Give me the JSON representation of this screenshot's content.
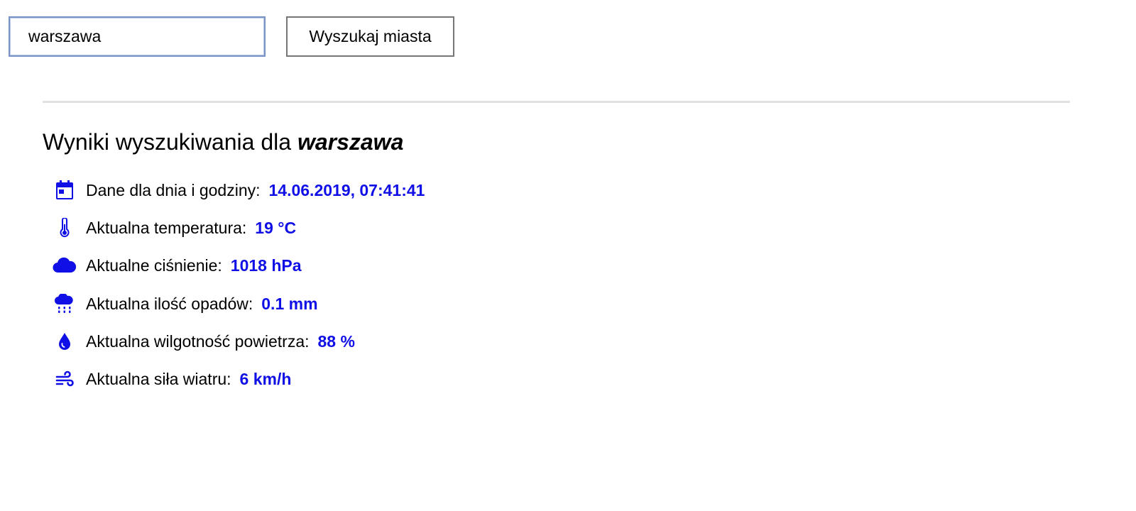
{
  "search": {
    "value": "warszawa",
    "button_label": "Wyszukaj miasta"
  },
  "results": {
    "heading_prefix": "Wyniki wyszukiwania dla ",
    "query": "warszawa",
    "accent_color": "#1010e6",
    "items": [
      {
        "icon": "calendar-icon",
        "label": "Dane dla dnia i godziny:",
        "value": "14.06.2019, 07:41:41"
      },
      {
        "icon": "thermometer-icon",
        "label": "Aktualna temperatura:",
        "value": "19 °C"
      },
      {
        "icon": "cloud-icon",
        "label": "Aktualne ciśnienie:",
        "value": "1018 hPa"
      },
      {
        "icon": "cloud-rain-icon",
        "label": "Aktualna ilość opadów:",
        "value": "0.1 mm"
      },
      {
        "icon": "droplet-icon",
        "label": "Aktualna wilgotność powietrza:",
        "value": "88 %"
      },
      {
        "icon": "wind-icon",
        "label": "Aktualna siła wiatru:",
        "value": "6 km/h"
      }
    ]
  }
}
